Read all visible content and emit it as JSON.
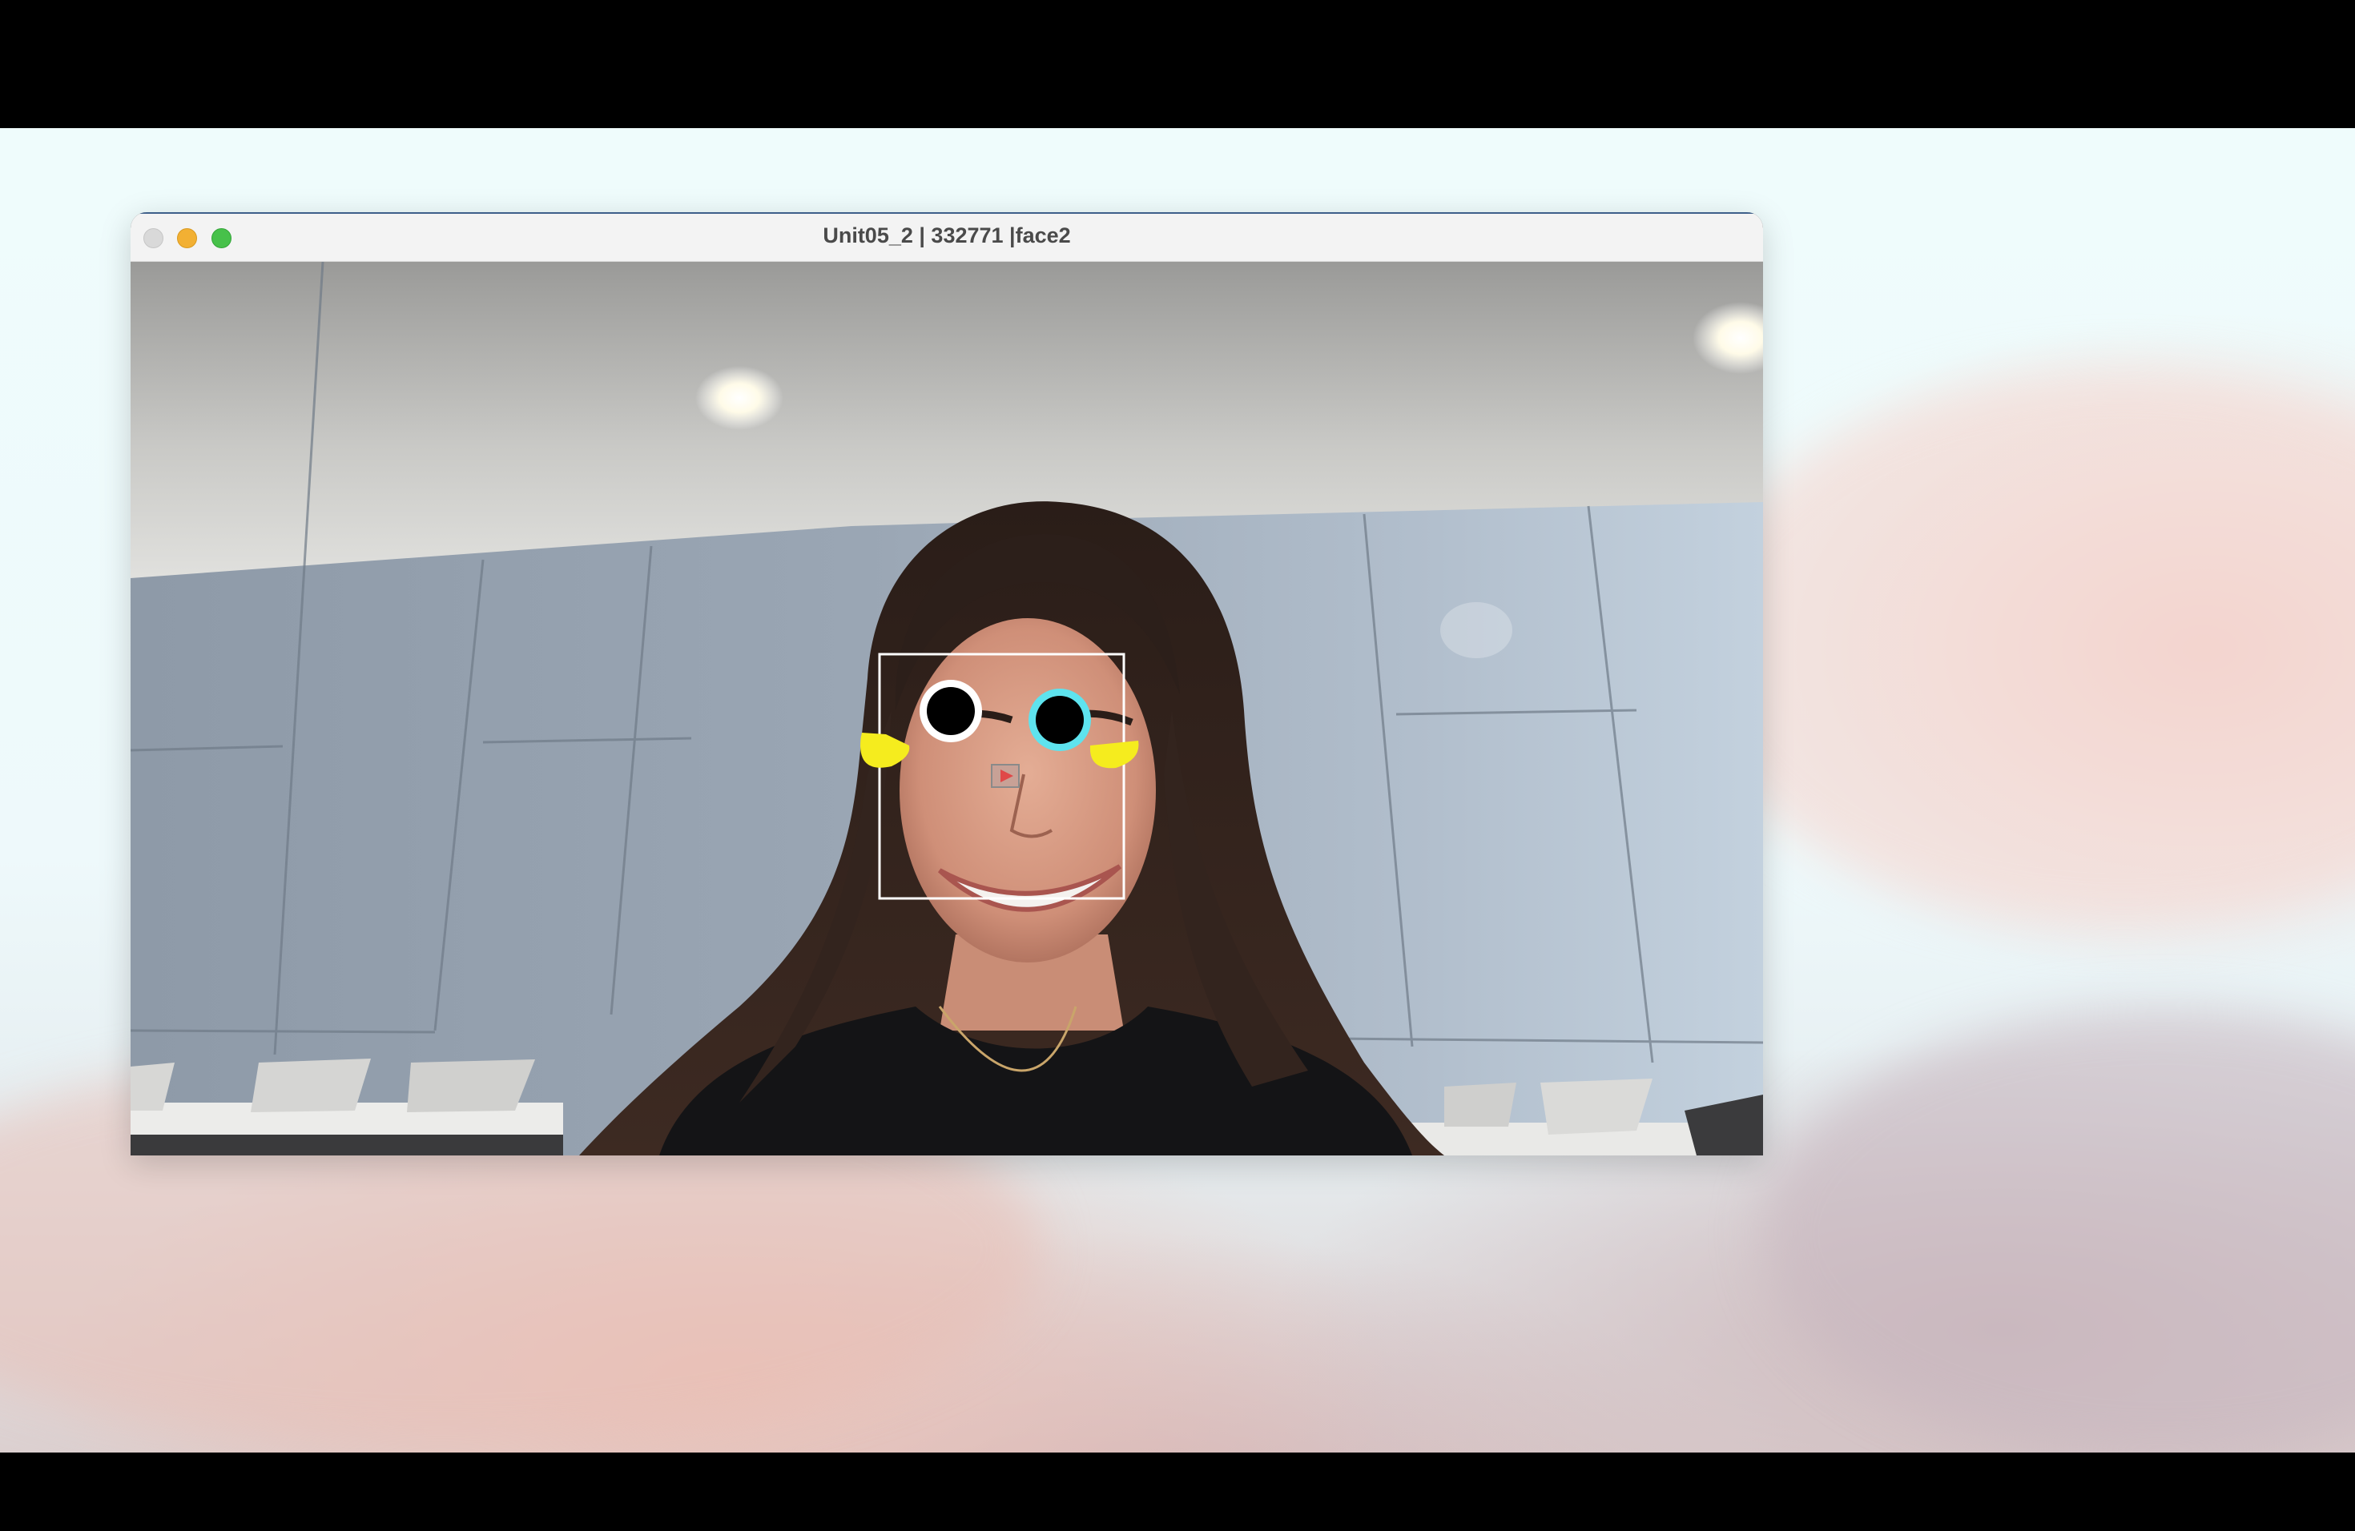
{
  "window": {
    "title": "Unit05_2 | 332771 |face2"
  },
  "traffic_lights": {
    "close": "close-button",
    "minimize": "minimize-button",
    "maximize": "maximize-button"
  },
  "overlay": {
    "left_eye_ring_color": "#ffffff",
    "right_eye_ring_color": "#5ee3ee",
    "pupil_color": "#000000",
    "cheek_color": "#f5ec1e",
    "face_box_color": "#ffffff",
    "nose_marker_color": "#e04848"
  },
  "colors": {
    "desktop_top": "#effcfc",
    "titlebar": "#f3f3f3",
    "close": "#d9d9d9",
    "minimize": "#f2b033",
    "maximize": "#47c14a"
  }
}
